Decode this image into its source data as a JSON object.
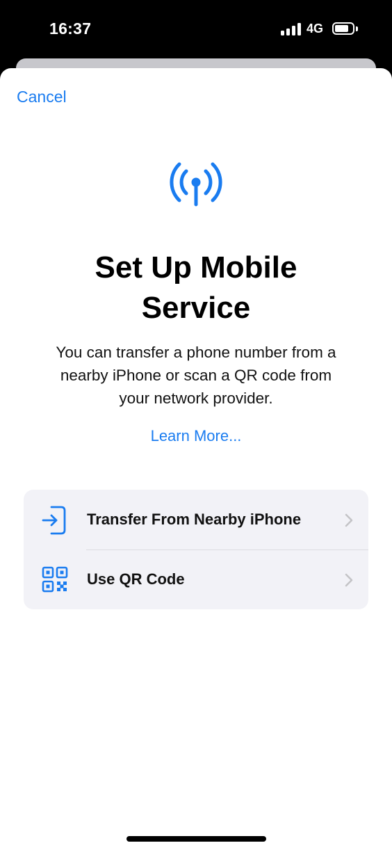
{
  "status_bar": {
    "time": "16:37",
    "network": "4G",
    "signal_bars": 4,
    "battery_level": 0.8
  },
  "sheet": {
    "cancel_label": "Cancel",
    "hero_icon": "antenna-radiowaves-icon",
    "title": "Set Up Mobile Service",
    "subtitle": "You can transfer a phone number from a nearby iPhone or scan a QR code from your network provider.",
    "learn_more": "Learn More..."
  },
  "options": [
    {
      "label": "Transfer From Nearby iPhone",
      "icon": "phone-transfer-icon"
    },
    {
      "label": "Use QR Code",
      "icon": "qr-code-icon"
    }
  ],
  "colors": {
    "accent": "#1a7cf0",
    "list_background": "#f2f2f7",
    "chevron": "#c4c4c7"
  }
}
